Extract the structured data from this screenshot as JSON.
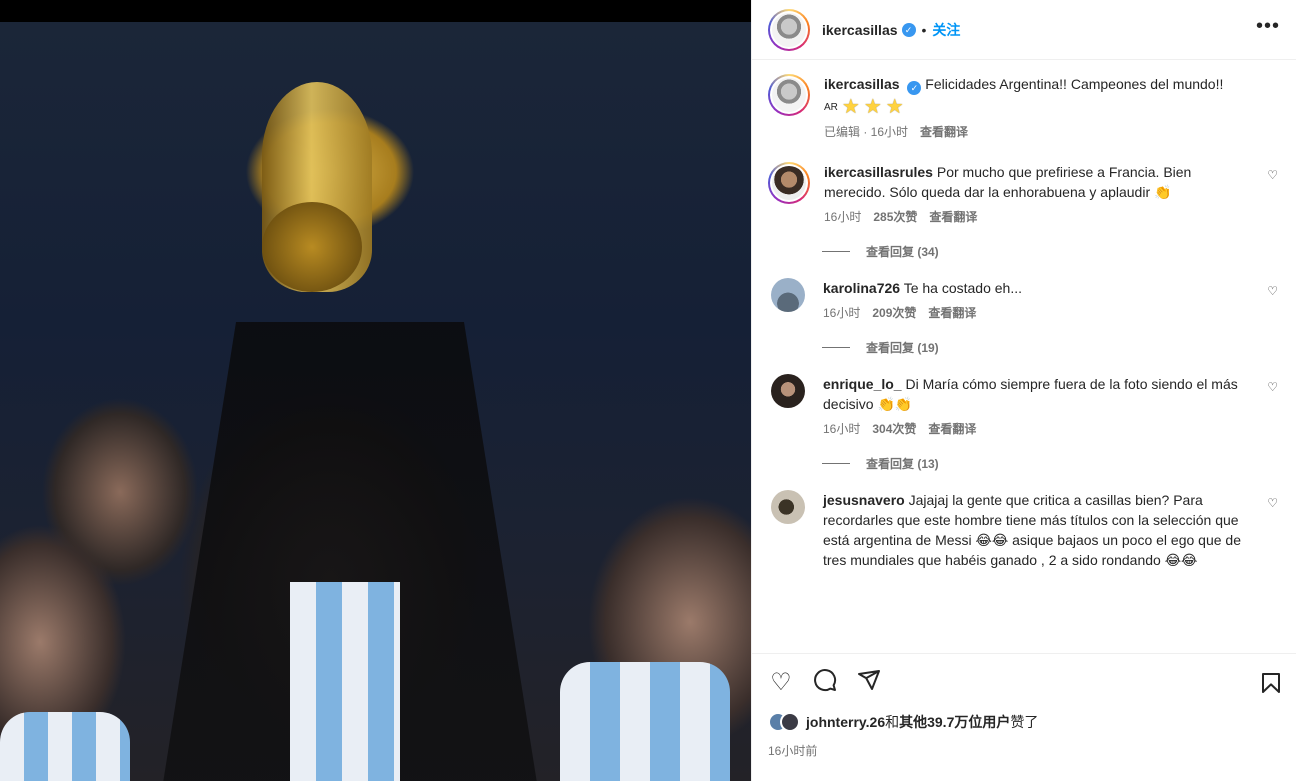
{
  "post": {
    "username": "ikercasillas",
    "verified_mark": "✓",
    "follow_label": "关注",
    "dot": "•",
    "more_label": "•••",
    "caption": "Felicidades Argentina!! Campeones del mundo!!",
    "flag_label": "AR",
    "stars": [
      "★",
      "★",
      "★"
    ],
    "edited": "已编辑 · 16小时",
    "translate": "查看翻译"
  },
  "comments": [
    {
      "username": "ikercasillasrules",
      "text": "Por mucho que prefiriese a Francia. Bien merecido. Sólo queda dar la enhorabuena y aplaudir 👏",
      "time": "16小时",
      "likes": "285次赞",
      "translate": "查看翻译",
      "replies": "查看回复 (34)"
    },
    {
      "username": "karolina726",
      "text": "Te ha costado eh...",
      "time": "16小时",
      "likes": "209次赞",
      "translate": "查看翻译",
      "replies": "查看回复 (19)"
    },
    {
      "username": "enrique_lo_",
      "text": "Di María cómo siempre fuera de la foto siendo el más decisivo 👏👏",
      "time": "16小时",
      "likes": "304次赞",
      "translate": "查看翻译",
      "replies": "查看回复 (13)"
    },
    {
      "username": "jesusnavero",
      "text": "Jajajaj la gente que critica a casillas bien? Para recordarles que este hombre tiene más títulos con la selección que está argentina de Messi 😂😂 asique bajaos un poco el ego que de tres mundiales que habéis ganado , 2 a sido rondando 😂😂"
    }
  ],
  "actions": {
    "like_icon": "♡",
    "comment_icon": "◯",
    "share_icon": "➢",
    "likes_user": "johnterry.26",
    "likes_and": "和",
    "likes_others": "其他39.7万位用户",
    "likes_suffix": "赞了",
    "time_ago": "16小时前"
  },
  "colors": {
    "link": "#0095f6",
    "verified": "#3897f0",
    "muted": "#737373"
  }
}
